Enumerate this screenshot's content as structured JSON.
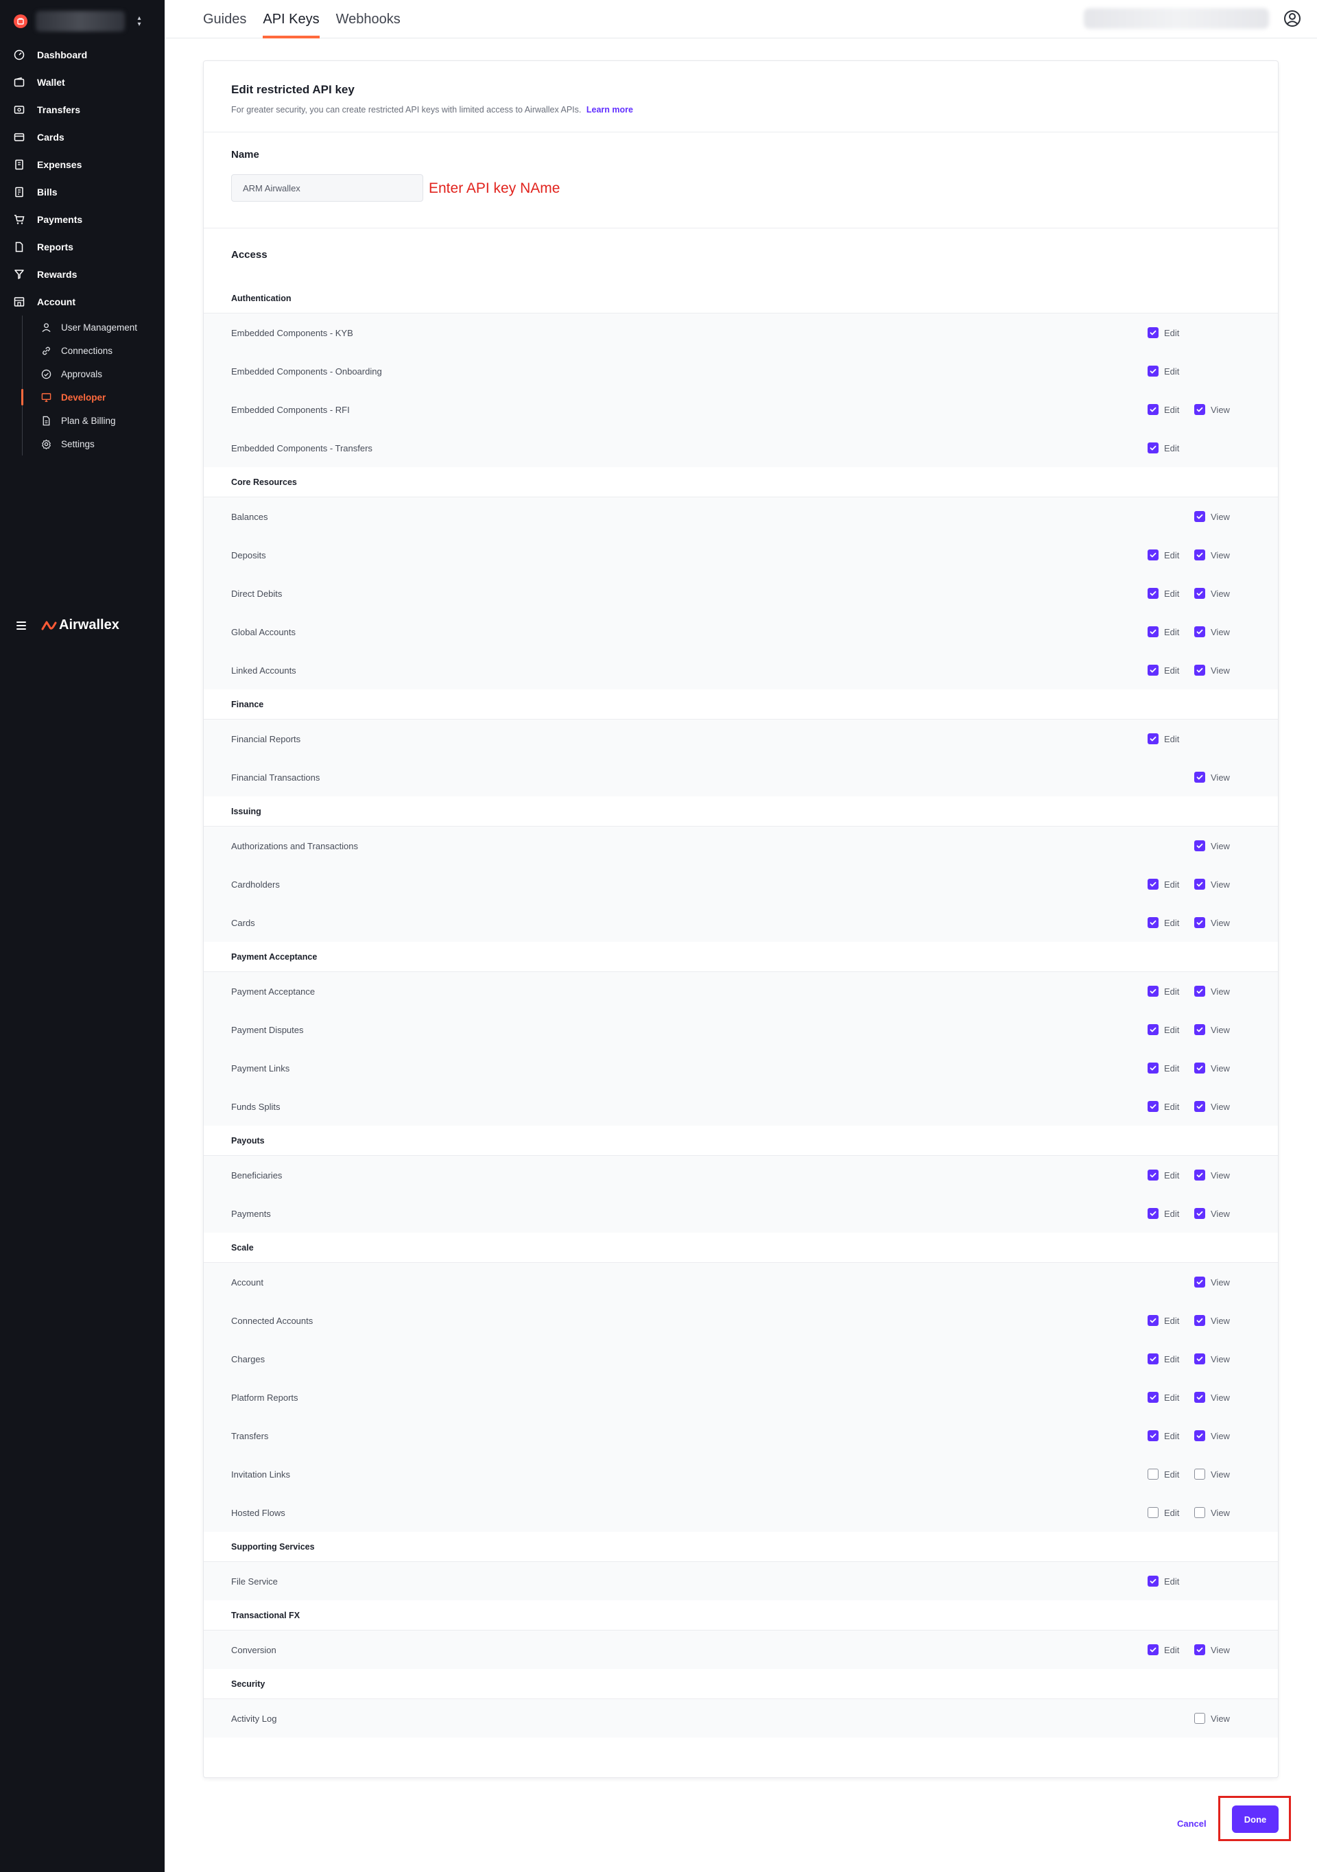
{
  "colors": {
    "accent": "#612fff",
    "brand": "#ff6a3d",
    "sidebar_bg": "#12141a",
    "annotation": "#e1231d"
  },
  "sidebar": {
    "nav": [
      {
        "label": "Dashboard",
        "icon": "dashboard-icon"
      },
      {
        "label": "Wallet",
        "icon": "wallet-icon"
      },
      {
        "label": "Transfers",
        "icon": "transfers-icon"
      },
      {
        "label": "Cards",
        "icon": "card-icon"
      },
      {
        "label": "Expenses",
        "icon": "expenses-icon"
      },
      {
        "label": "Bills",
        "icon": "bills-icon"
      },
      {
        "label": "Payments",
        "icon": "cart-icon"
      },
      {
        "label": "Reports",
        "icon": "report-icon"
      },
      {
        "label": "Rewards",
        "icon": "trophy-icon"
      },
      {
        "label": "Account",
        "icon": "store-icon"
      }
    ],
    "account_sub": [
      {
        "label": "User Management",
        "icon": "user-icon"
      },
      {
        "label": "Connections",
        "icon": "link-icon"
      },
      {
        "label": "Approvals",
        "icon": "check-circle-icon"
      },
      {
        "label": "Developer",
        "icon": "monitor-icon"
      },
      {
        "label": "Plan & Billing",
        "icon": "document-icon"
      },
      {
        "label": "Settings",
        "icon": "gear-icon"
      }
    ],
    "brand": "Airwallex"
  },
  "topbar": {
    "tabs": [
      "Guides",
      "API Keys",
      "Webhooks"
    ],
    "active_tab": "API Keys"
  },
  "card": {
    "title": "Edit restricted API key",
    "subtitle": "For greater security, you can create restricted API keys with limited access to Airwallex APIs.",
    "learn_more": "Learn more",
    "name_label": "Name",
    "name_value": "ARM Airwallex",
    "name_annotation": "Enter API key NAme",
    "access_label": "Access",
    "edit_label": "Edit",
    "view_label": "View"
  },
  "groups": [
    {
      "title": "Authentication",
      "rows": [
        {
          "label": "Embedded Components - KYB",
          "edit": true,
          "view": null
        },
        {
          "label": "Embedded Components - Onboarding",
          "edit": true,
          "view": null
        },
        {
          "label": "Embedded Components - RFI",
          "edit": true,
          "view": true
        },
        {
          "label": "Embedded Components - Transfers",
          "edit": true,
          "view": null
        }
      ]
    },
    {
      "title": "Core Resources",
      "rows": [
        {
          "label": "Balances",
          "edit": null,
          "view": true
        },
        {
          "label": "Deposits",
          "edit": true,
          "view": true
        },
        {
          "label": "Direct Debits",
          "edit": true,
          "view": true
        },
        {
          "label": "Global Accounts",
          "edit": true,
          "view": true
        },
        {
          "label": "Linked Accounts",
          "edit": true,
          "view": true
        }
      ]
    },
    {
      "title": "Finance",
      "rows": [
        {
          "label": "Financial Reports",
          "edit": true,
          "view": null
        },
        {
          "label": "Financial Transactions",
          "edit": null,
          "view": true
        }
      ]
    },
    {
      "title": "Issuing",
      "rows": [
        {
          "label": "Authorizations and Transactions",
          "edit": null,
          "view": true
        },
        {
          "label": "Cardholders",
          "edit": true,
          "view": true
        },
        {
          "label": "Cards",
          "edit": true,
          "view": true
        }
      ]
    },
    {
      "title": "Payment Acceptance",
      "rows": [
        {
          "label": "Payment Acceptance",
          "edit": true,
          "view": true
        },
        {
          "label": "Payment Disputes",
          "edit": true,
          "view": true
        },
        {
          "label": "Payment Links",
          "edit": true,
          "view": true
        },
        {
          "label": "Funds Splits",
          "edit": true,
          "view": true
        }
      ]
    },
    {
      "title": "Payouts",
      "rows": [
        {
          "label": "Beneficiaries",
          "edit": true,
          "view": true
        },
        {
          "label": "Payments",
          "edit": true,
          "view": true
        }
      ]
    },
    {
      "title": "Scale",
      "rows": [
        {
          "label": "Account",
          "edit": null,
          "view": true
        },
        {
          "label": "Connected Accounts",
          "edit": true,
          "view": true
        },
        {
          "label": "Charges",
          "edit": true,
          "view": true
        },
        {
          "label": "Platform Reports",
          "edit": true,
          "view": true
        },
        {
          "label": "Transfers",
          "edit": true,
          "view": true
        },
        {
          "label": "Invitation Links",
          "edit": false,
          "view": false
        },
        {
          "label": "Hosted Flows",
          "edit": false,
          "view": false
        }
      ]
    },
    {
      "title": "Supporting Services",
      "rows": [
        {
          "label": "File Service",
          "edit": true,
          "view": null
        }
      ]
    },
    {
      "title": "Transactional FX",
      "rows": [
        {
          "label": "Conversion",
          "edit": true,
          "view": true
        }
      ]
    },
    {
      "title": "Security",
      "rows": [
        {
          "label": "Activity Log",
          "edit": null,
          "view": false
        }
      ]
    }
  ],
  "footer": {
    "cancel": "Cancel",
    "done": "Done"
  }
}
